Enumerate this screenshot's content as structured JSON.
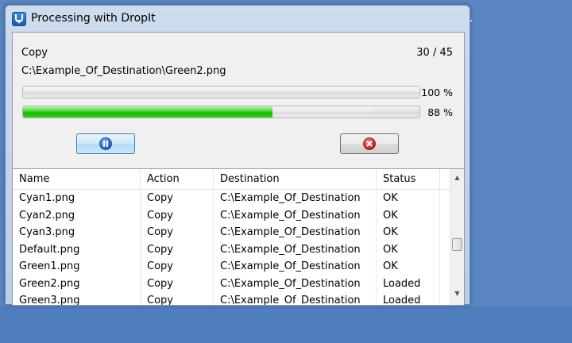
{
  "window": {
    "title": "Processing with DropIt",
    "icon": "dropit-arrow-icon"
  },
  "progress": {
    "operation": "Copy",
    "count": "30 / 45",
    "current_path": "C:\\Example_Of_Destination\\Green2.png",
    "file_percent": 100,
    "file_percent_label": "100 %",
    "total_percent": 88,
    "total_percent_label": "88 %",
    "total_green_fill_percent": 63
  },
  "buttons": {
    "pause_icon": "pause-icon",
    "cancel_icon": "cancel-icon"
  },
  "list": {
    "columns": [
      "Name",
      "Action",
      "Destination",
      "Status"
    ],
    "rows": [
      {
        "name": "Cyan1.png",
        "action": "Copy",
        "destination": "C:\\Example_Of_Destination",
        "status": "OK"
      },
      {
        "name": "Cyan2.png",
        "action": "Copy",
        "destination": "C:\\Example_Of_Destination",
        "status": "OK"
      },
      {
        "name": "Cyan3.png",
        "action": "Copy",
        "destination": "C:\\Example_Of_Destination",
        "status": "OK"
      },
      {
        "name": "Default.png",
        "action": "Copy",
        "destination": "C:\\Example_Of_Destination",
        "status": "OK"
      },
      {
        "name": "Green1.png",
        "action": "Copy",
        "destination": "C:\\Example_Of_Destination",
        "status": "OK"
      },
      {
        "name": "Green2.png",
        "action": "Copy",
        "destination": "C:\\Example_Of_Destination",
        "status": "Loaded"
      },
      {
        "name": "Green3.png",
        "action": "Copy",
        "destination": "C:\\Example_Of_Destination",
        "status": "Loaded"
      }
    ],
    "scroll_position_fraction": 0.6
  },
  "colors": {
    "desktop": "#5a86c4",
    "progress_green": "#17b500",
    "accent_blue": "#3c7fb1"
  }
}
